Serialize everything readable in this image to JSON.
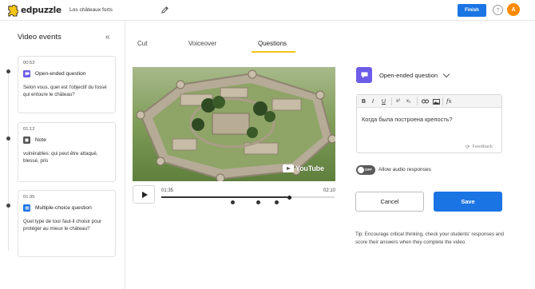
{
  "header": {
    "brand": "edpuzzle",
    "project_title": "Los châteaux forts",
    "finish_label": "Finish",
    "help_glyph": "?",
    "avatar_initial": "A",
    "icons": {
      "logo": "edpuzzle-logo-icon",
      "edit": "pencil-icon",
      "help": "question-circle-icon"
    }
  },
  "sidebar": {
    "title": "Video events",
    "collapse_glyph": "«",
    "events": [
      {
        "time": "00:53",
        "type": "Open-ended question",
        "text": "Selon vous, quel est l'objectif du fossé qui entoure le château?",
        "icon": "speech-bubble-icon",
        "icon_color": "#6c5ce7"
      },
      {
        "time": "01:12",
        "type": "Note",
        "text": "vulnérables: qui peut être attaqué, blessé, pris",
        "icon": "note-icon",
        "icon_color": "#555555"
      },
      {
        "time": "01:35",
        "type": "Multiple-choice question",
        "text": "Quel type de tour faut-il choisir pour protéger au mieux le château?",
        "icon": "list-icon",
        "icon_color": "#1b74e4"
      }
    ]
  },
  "tabs": [
    {
      "label": "Cut",
      "active": false
    },
    {
      "label": "Voiceover",
      "active": false
    },
    {
      "label": "Questions",
      "active": true
    }
  ],
  "player": {
    "watermark": "YouTube",
    "current_time": "01:35",
    "total_time": "02:10",
    "progress": 0.73
  },
  "question": {
    "type_label": "Open-ended question",
    "toolbar": [
      "B",
      "I",
      "U",
      "x²",
      "x₂",
      "link",
      "image",
      "fx"
    ],
    "text": "Когда была построена крепость?",
    "feedback_label": "Feedback"
  },
  "audio": {
    "toggle_state": "OFF",
    "label": "Allow audio responses"
  },
  "actions": {
    "cancel_label": "Cancel",
    "save_label": "Save"
  },
  "tip": "Tip: Encourage critical thinking, check your students' responses and score their answers when they complete the video.",
  "colors": {
    "accent": "#1b74e4",
    "open_ended": "#6c5ce7",
    "tab_underline": "#f5c518",
    "avatar": "#ff8a00"
  }
}
